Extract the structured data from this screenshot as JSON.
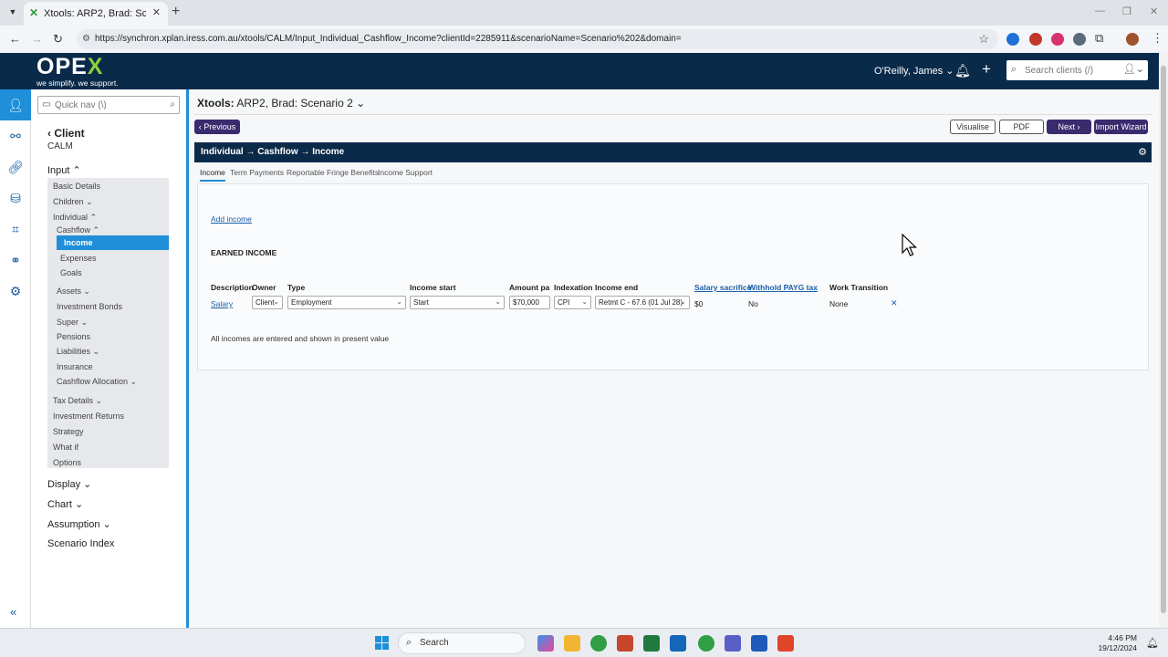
{
  "browser": {
    "tab_title": "Xtools: ARP2, Brad: Scenario 2 | ",
    "url": "https://synchron.xplan.iress.com.au/xtools/CALM/Input_Individual_Cashflow_Income?clientId=2285911&scenarioName=Scenario%202&domain="
  },
  "header": {
    "logo": "OPEX",
    "logo_tagline": "we simplify. we support.",
    "user": "O'Reilly, James",
    "search_placeholder": "Search clients (/)"
  },
  "sidebar": {
    "quicknav_placeholder": "Quick nav (\\)",
    "client_label": "Client",
    "client_sub": "CALM",
    "input_label": "Input",
    "items": {
      "basic_details": "Basic Details",
      "children": "Children",
      "individual": "Individual",
      "cashflow": "Cashflow",
      "income": "Income",
      "expenses": "Expenses",
      "goals": "Goals",
      "assets": "Assets",
      "investment_bonds": "Investment Bonds",
      "super": "Super",
      "pensions": "Pensions",
      "liabilities": "Liabilities",
      "insurance": "Insurance",
      "cashflow_allocation": "Cashflow Allocation",
      "tax_details": "Tax Details",
      "investment_returns": "Investment Returns",
      "strategy": "Strategy",
      "what_if": "What if",
      "options": "Options"
    },
    "display_label": "Display",
    "chart_label": "Chart",
    "assumption_label": "Assumption",
    "scenario_index_label": "Scenario Index"
  },
  "main": {
    "crumb_app": "Xtools:",
    "crumb_rest": "ARP2, Brad: Scenario 2",
    "buttons": {
      "previous": "Previous",
      "visualise": "Visualise",
      "pdf": "PDF",
      "next": "Next",
      "import_wizard": "Import Wizard"
    },
    "panel_title": "Individual → Cashflow → Income",
    "tabs": [
      "Income",
      "Term Payments",
      "Reportable Fringe Benefits",
      "Income Support"
    ],
    "add_income": "Add income",
    "earned_income": "EARNED INCOME",
    "columns": [
      "Description",
      "Owner",
      "Type",
      "Income start",
      "Amount pa",
      "Indexation",
      "Income end",
      "Salary sacrifice",
      "Withhold PAYG tax",
      "Work Transition"
    ],
    "row": {
      "description": "Salary",
      "owner": "Client",
      "type": "Employment",
      "income_start": "Start",
      "amount": "$70,000",
      "indexation": "CPI",
      "income_end": "Retmt C - 67.6 (01 Jul 28)",
      "salary_sacrifice": "$0",
      "withhold_payg": "No",
      "work_transition": "None"
    },
    "note": "All incomes are entered and shown in present value"
  },
  "taskbar": {
    "search": "Search",
    "time": "4:46 PM",
    "date": "19/12/2024"
  }
}
